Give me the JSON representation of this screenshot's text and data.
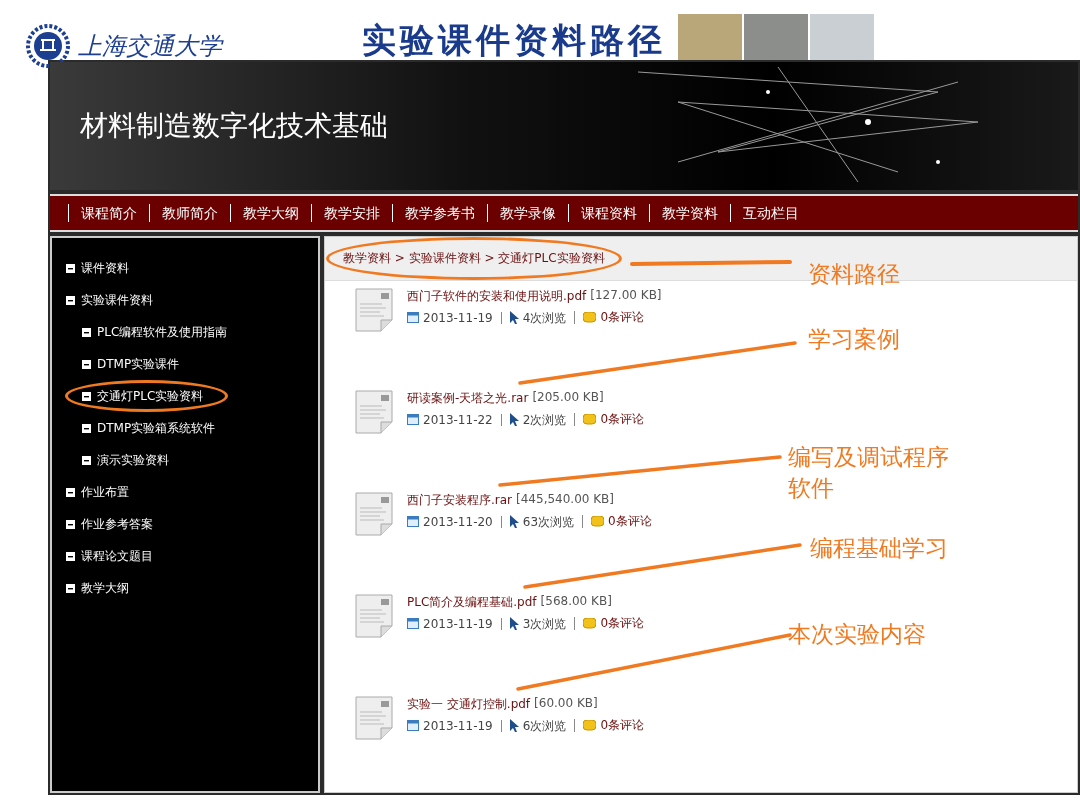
{
  "slide": {
    "logo_text": "上海交通大学",
    "title": "实验课件资料路径"
  },
  "site": {
    "title": "材料制造数字化技术基础",
    "nav": [
      "课程简介",
      "教师简介",
      "教学大纲",
      "教学安排",
      "教学参考书",
      "教学录像",
      "课程资料",
      "教学资料",
      "互动栏目"
    ]
  },
  "sidebar": {
    "items": [
      {
        "label": "课件资料",
        "circled": false
      },
      {
        "label": "实验课件资料",
        "circled": false,
        "children": [
          {
            "label": "PLC编程软件及使用指南",
            "circled": false
          },
          {
            "label": "DTMP实验课件",
            "circled": false
          },
          {
            "label": "交通灯PLC实验资料",
            "circled": true
          },
          {
            "label": "DTMP实验箱系统软件",
            "circled": false
          },
          {
            "label": "演示实验资料",
            "circled": false
          }
        ]
      },
      {
        "label": "作业布置",
        "circled": false
      },
      {
        "label": "作业参考答案",
        "circled": false
      },
      {
        "label": "课程论文题目",
        "circled": false
      },
      {
        "label": "教学大纲",
        "circled": false
      }
    ]
  },
  "breadcrumb": {
    "text": "教学资料 > 实验课件资料 > 交通灯PLC实验资料",
    "circled": true
  },
  "files": [
    {
      "name": "西门子软件的安装和使用说明.pdf",
      "size": "[127.00 KB]",
      "date": "2013-11-19",
      "views": "4次浏览",
      "comments": "0条评论"
    },
    {
      "name": "研读案例-天塔之光.rar",
      "size": "[205.00 KB]",
      "date": "2013-11-22",
      "views": "2次浏览",
      "comments": "0条评论"
    },
    {
      "name": "西门子安装程序.rar",
      "size": "[445,540.00 KB]",
      "date": "2013-11-20",
      "views": "63次浏览",
      "comments": "0条评论"
    },
    {
      "name": "PLC简介及编程基础.pdf",
      "size": "[568.00 KB]",
      "date": "2013-11-19",
      "views": "3次浏览",
      "comments": "0条评论"
    },
    {
      "name": "实验一 交通灯控制.pdf",
      "size": "[60.00 KB]",
      "date": "2013-11-19",
      "views": "6次浏览",
      "comments": "0条评论"
    }
  ],
  "annotations": [
    {
      "text": "资料路径",
      "kind": "path"
    },
    {
      "text": "学习案例",
      "kind": "file"
    },
    {
      "text": "编写及调试程序软件",
      "kind": "file"
    },
    {
      "text": "编程基础学习",
      "kind": "file"
    },
    {
      "text": "本次实验内容",
      "kind": "file"
    }
  ]
}
